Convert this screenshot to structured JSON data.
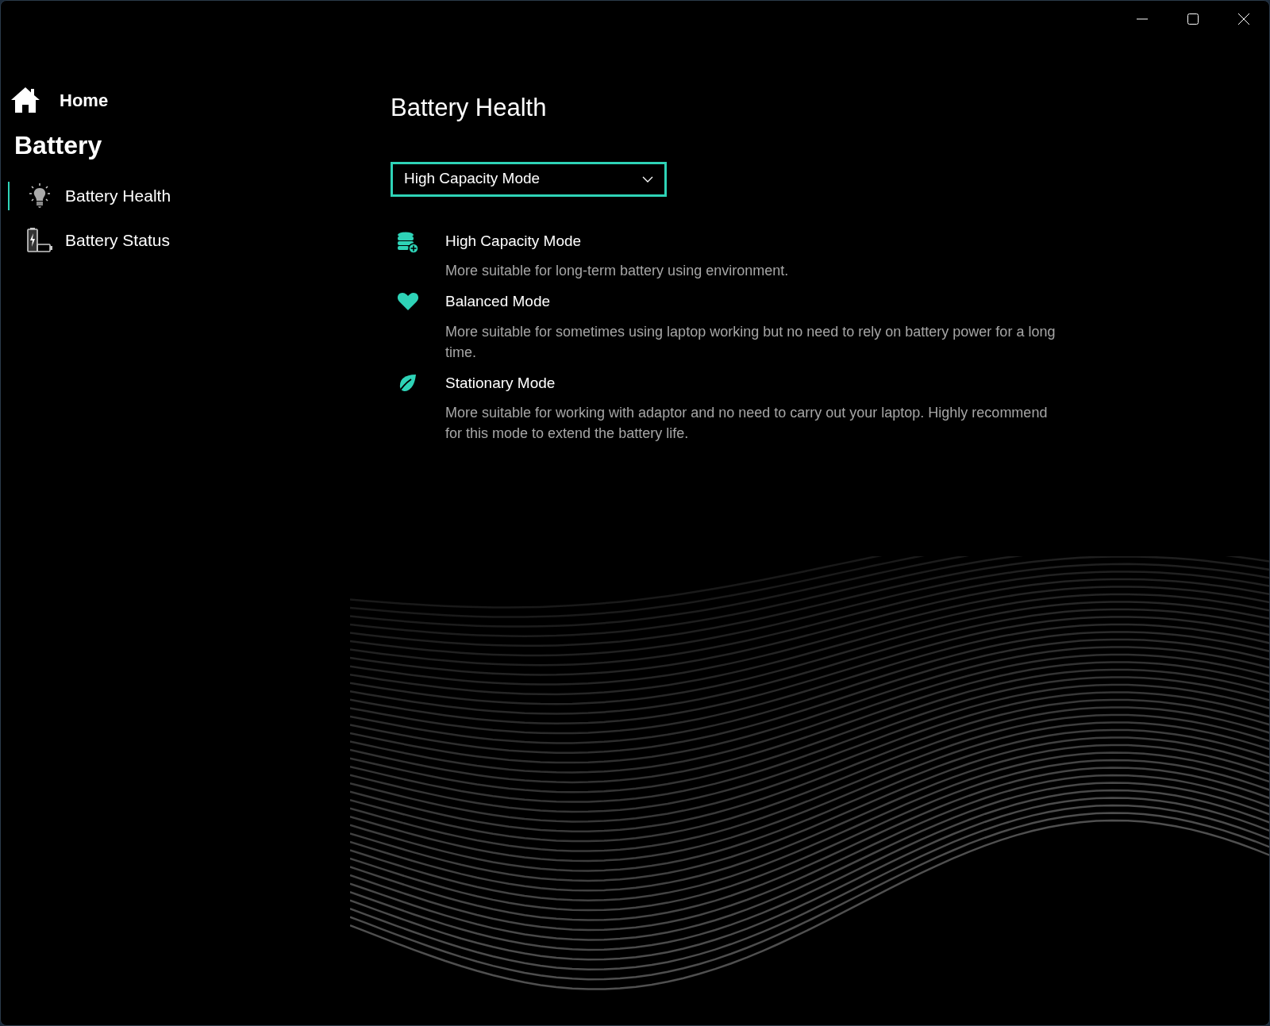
{
  "sidebar": {
    "home": "Home",
    "section": "Battery",
    "items": [
      {
        "label": "Battery Health",
        "kind": "health",
        "selected": true
      },
      {
        "label": "Battery Status",
        "kind": "status",
        "selected": false
      }
    ]
  },
  "main": {
    "title": "Battery Health",
    "dropdown": {
      "value": "High Capacity Mode"
    },
    "modes": [
      {
        "kind": "capacity",
        "title": "High Capacity Mode",
        "description": "More suitable for long-term battery using environment."
      },
      {
        "kind": "balanced",
        "title": "Balanced Mode",
        "description": "More suitable for sometimes using laptop working but no need to rely on battery power for a long time."
      },
      {
        "kind": "stationary",
        "title": "Stationary Mode",
        "description": "More suitable for working with adaptor and no need to carry out your laptop. Highly recommend for this mode to extend the battery life."
      }
    ]
  }
}
